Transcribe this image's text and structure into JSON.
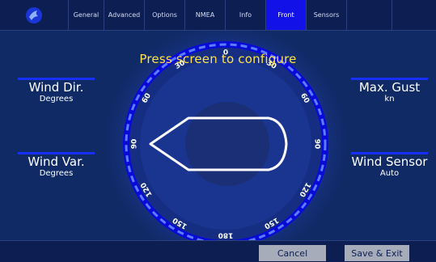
{
  "tabs": [
    {
      "label": "General",
      "active": false
    },
    {
      "label": "Advanced",
      "active": false
    },
    {
      "label": "Options",
      "active": false
    },
    {
      "label": "NMEA",
      "active": false
    },
    {
      "label": "Info",
      "active": false
    },
    {
      "label": "Front",
      "active": true
    },
    {
      "label": "Sensors",
      "active": false
    }
  ],
  "logo_icon": "bird-logo-icon",
  "hint": "Press screen to configure",
  "fields": {
    "wind_dir": {
      "title": "Wind Dir.",
      "unit": "Degrees"
    },
    "wind_var": {
      "title": "Wind Var.",
      "unit": "Degrees"
    },
    "max_gust": {
      "title": "Max. Gust",
      "unit": "kn"
    },
    "wind_sensor": {
      "title": "Wind Sensor",
      "unit": "Auto"
    }
  },
  "dial": {
    "labels": [
      "0",
      "30",
      "60",
      "90",
      "120",
      "150",
      "180",
      "150",
      "120",
      "90",
      "60",
      "30"
    ],
    "boat_icon": "boat-outline-icon"
  },
  "buttons": {
    "cancel": "Cancel",
    "save_exit": "Save & Exit"
  },
  "colors": {
    "background": "#102a66",
    "active_tab": "#1212e8",
    "hint": "#ffe24a",
    "accent": "#1830ff"
  }
}
